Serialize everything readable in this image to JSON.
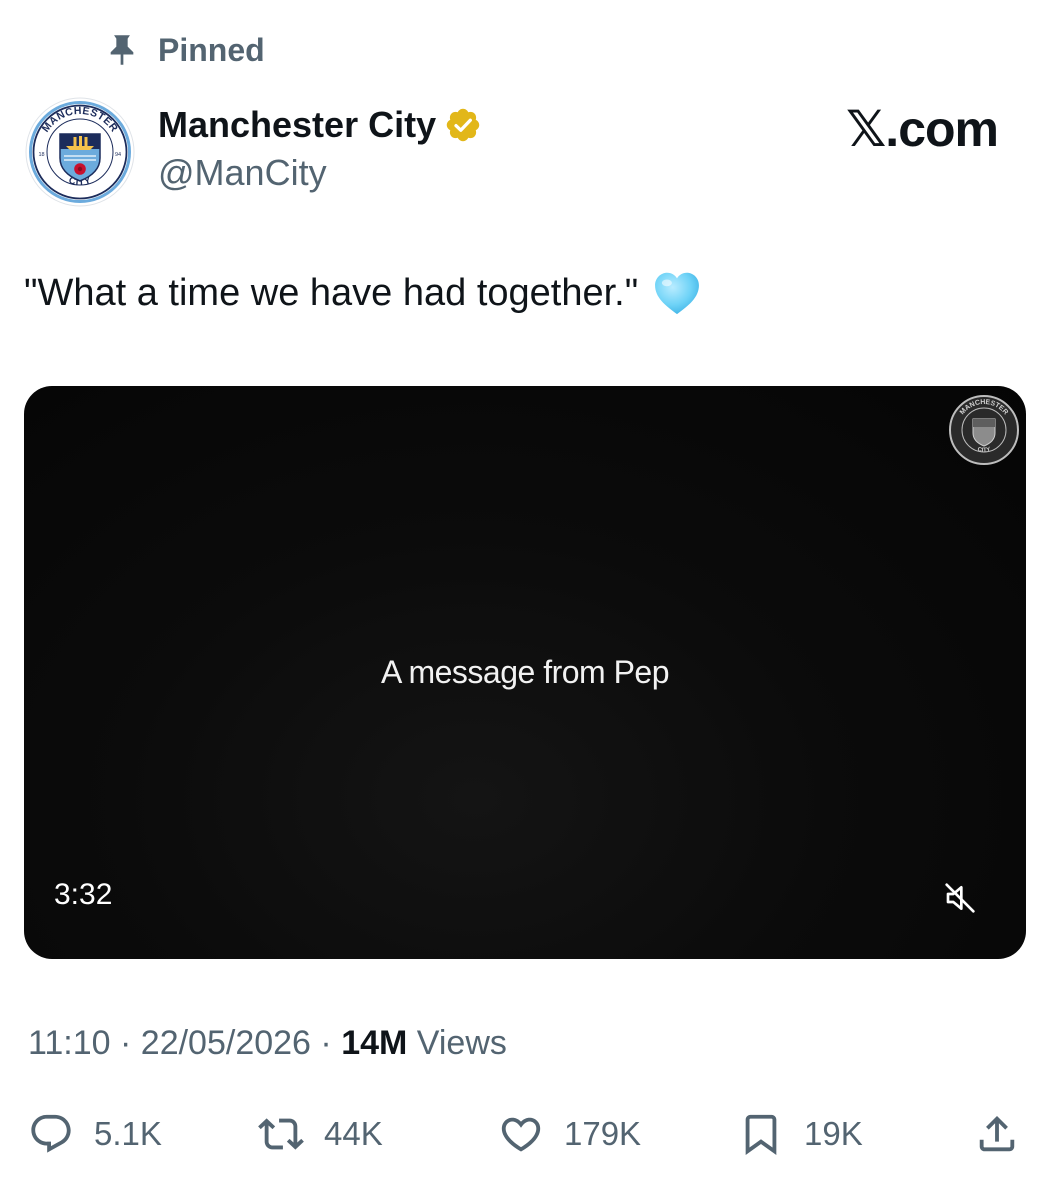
{
  "pinned": {
    "label": "Pinned",
    "icon": "pin-icon"
  },
  "author": {
    "display_name": "Manchester City",
    "handle": "@ManCity",
    "verified_icon": "verified-gold-badge-icon",
    "avatar_icon": "manchester-city-crest",
    "avatar_text_top": "MANCHESTER",
    "avatar_text_bottom": "CITY",
    "avatar_year_left": "18",
    "avatar_year_right": "94"
  },
  "watermark": "𝕏.com",
  "tweet": {
    "text": "\"What a time we have had together.\"",
    "emoji": "light-blue-heart-emoji"
  },
  "video": {
    "caption": "A message from Pep",
    "duration": "3:32",
    "badge_icon": "manchester-city-crest-watermark",
    "badge_text_top": "MANCHESTER",
    "badge_text_bottom": "CITY",
    "mute_icon": "speaker-muted-icon"
  },
  "meta": {
    "time": "11:10",
    "date": "22/05/2026",
    "separator": "·",
    "views_count": "14M",
    "views_label": "Views"
  },
  "actions": {
    "reply": {
      "icon": "reply-icon",
      "count": "5.1K"
    },
    "repost": {
      "icon": "repost-icon",
      "count": "44K"
    },
    "like": {
      "icon": "heart-icon",
      "count": "179K"
    },
    "bookmark": {
      "icon": "bookmark-icon",
      "count": "19K"
    },
    "share": {
      "icon": "share-icon"
    }
  },
  "colors": {
    "secondary_text": "#536471",
    "primary_text": "#0f1419",
    "verified_gold": "#e2b719",
    "city_blue": "#6cabdd",
    "crest_navy": "#1c2c5b"
  }
}
